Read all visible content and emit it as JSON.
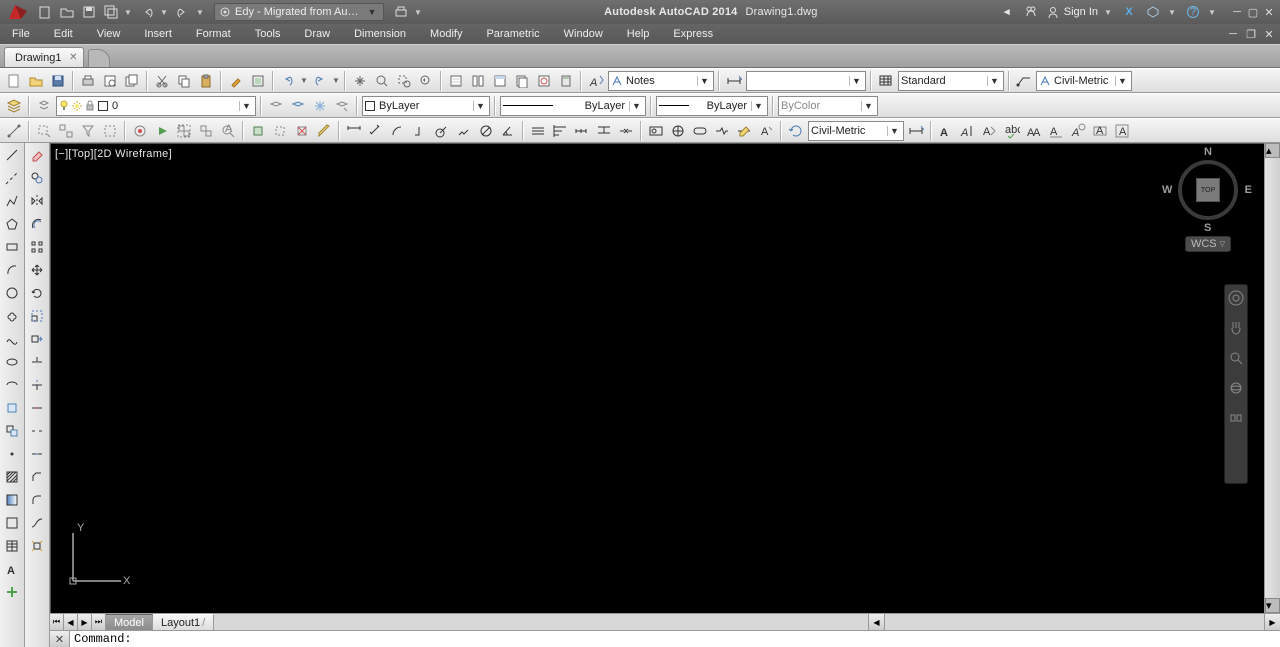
{
  "title": {
    "app": "Autodesk AutoCAD 2014",
    "file": "Drawing1.dwg"
  },
  "workspace": {
    "label": "Edy - Migrated from AutoC..."
  },
  "signin": {
    "label": "Sign In"
  },
  "menu": [
    "File",
    "Edit",
    "View",
    "Insert",
    "Format",
    "Tools",
    "Draw",
    "Dimension",
    "Modify",
    "Parametric",
    "Window",
    "Help",
    "Express"
  ],
  "doc_tabs": {
    "active": "Drawing1"
  },
  "style_dd": {
    "notes": "Notes",
    "standard": "Standard",
    "civil": "Civil-Metric",
    "civil2": "Civil-Metric"
  },
  "layer": {
    "current": "0"
  },
  "props": {
    "color": "ByLayer",
    "linetype": "ByLayer",
    "lineweight": "ByLayer",
    "plotstyle": "ByColor"
  },
  "viewport": {
    "label": "[−][Top][2D Wireframe]"
  },
  "viewcube": {
    "top": "TOP",
    "n": "N",
    "s": "S",
    "e": "E",
    "w": "W",
    "wcs": "WCS"
  },
  "layout_tabs": {
    "model": "Model",
    "layout1": "Layout1"
  },
  "command": {
    "prompt": "Command:"
  },
  "ucs": {
    "x": "X",
    "y": "Y"
  }
}
